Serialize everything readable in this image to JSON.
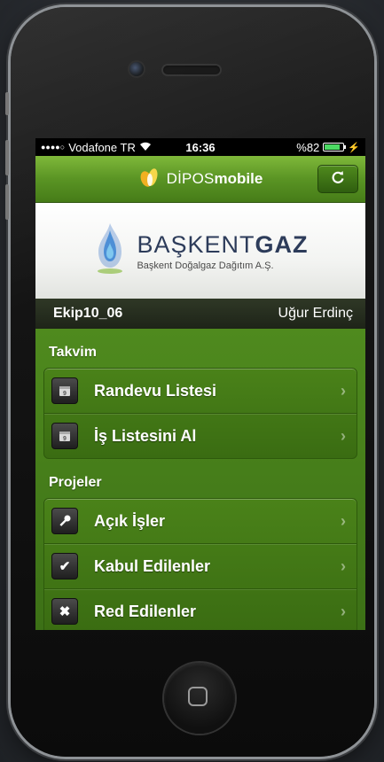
{
  "status_bar": {
    "signal": "●●●●○",
    "carrier": "Vodafone TR",
    "time": "16:36",
    "battery_text": "%82",
    "battery_level": 0.82
  },
  "header": {
    "logo_thin": "DİPOS",
    "logo_bold": "mobile",
    "refresh_icon": "refresh-icon"
  },
  "brand": {
    "name_regular": "BAŞKENT",
    "name_bold": "GAZ",
    "subtitle": "Başkent Doğalgaz Dağıtım A.Ş."
  },
  "user_bar": {
    "team": "Ekip10_06",
    "user": "Uğur Erdinç"
  },
  "sections": [
    {
      "title": "Takvim",
      "items": [
        {
          "label": "Randevu Listesi",
          "icon": "calendar-icon"
        },
        {
          "label": "İş Listesini Al",
          "icon": "calendar-icon"
        }
      ]
    },
    {
      "title": "Projeler",
      "items": [
        {
          "label": "Açık İşler",
          "icon": "key-icon"
        },
        {
          "label": "Kabul Edilenler",
          "icon": "checkmark-icon"
        },
        {
          "label": "Red Edilenler",
          "icon": "cross-icon"
        }
      ]
    }
  ],
  "colors": {
    "accent_green": "#5a9424",
    "brand_navy": "#2d3c5a"
  }
}
